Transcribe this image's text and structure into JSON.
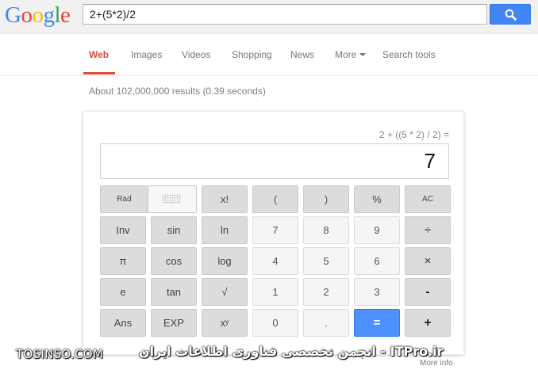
{
  "brand": {
    "logo_letters": [
      "G",
      "o",
      "o",
      "g",
      "l",
      "e"
    ],
    "logo_colors": [
      "#4285f4",
      "#ea4335",
      "#fbbc05",
      "#4285f4",
      "#34a853",
      "#ea4335"
    ]
  },
  "search": {
    "query": "2+(5*2)/2",
    "button_icon": "search-icon"
  },
  "nav": {
    "tabs": [
      {
        "label": "Web",
        "active": true
      },
      {
        "label": "Images"
      },
      {
        "label": "Videos"
      },
      {
        "label": "Shopping"
      },
      {
        "label": "News"
      },
      {
        "label": "More"
      },
      {
        "label": "Search tools"
      }
    ]
  },
  "result_stats": "About 102,000,000 results (0.39 seconds)",
  "calculator": {
    "expression": "2 + ((5 * 2) / 2) =",
    "display": "7",
    "angle_mode": {
      "rad": "Rad",
      "deg": ""
    },
    "rows": [
      [
        "x!",
        "(",
        ")",
        "%",
        "AC"
      ],
      [
        "Inv",
        "sin",
        "ln",
        "7",
        "8",
        "9",
        "÷"
      ],
      [
        "π",
        "cos",
        "log",
        "4",
        "5",
        "6",
        "×"
      ],
      [
        "e",
        "tan",
        "√",
        "1",
        "2",
        "3",
        "-"
      ],
      [
        "Ans",
        "EXP",
        "xʸ",
        "0",
        ".",
        "=",
        "+"
      ]
    ],
    "more_info": "More info"
  },
  "watermark": {
    "left": "TOSINSO.COM",
    "right": "انجمن تخصصی فناوری اطلاعات ایران - ITPro.ir"
  },
  "colors": {
    "accent": "#4285f4",
    "active_tab": "#dd4b39",
    "equals_key": "#4d90fe"
  }
}
